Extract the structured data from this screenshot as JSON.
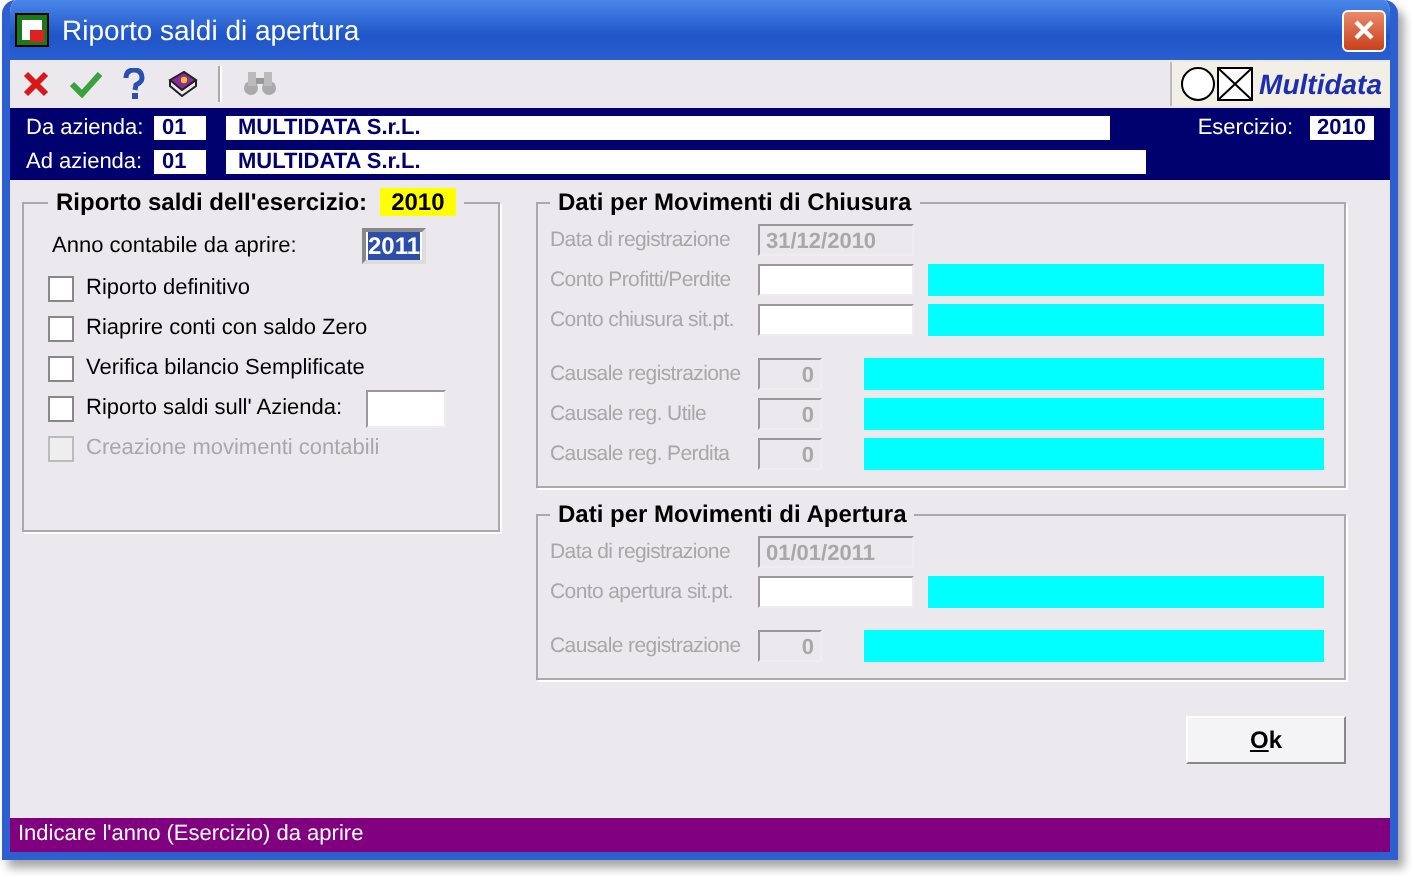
{
  "window": {
    "title": "Riporto saldi di apertura"
  },
  "toolbar": {
    "logo": "Multidata"
  },
  "header": {
    "from": {
      "label": "Da azienda:",
      "code": "01",
      "name": "MULTIDATA S.r.L."
    },
    "to": {
      "label": "Ad azienda:",
      "code": "01",
      "name": "MULTIDATA S.r.L."
    },
    "year": {
      "label": "Esercizio:",
      "value": "2010"
    }
  },
  "left": {
    "title": "Riporto saldi dell'esercizio:",
    "year": "2010",
    "open_year": {
      "label": "Anno contabile da aprire:",
      "value": "2011"
    },
    "options": [
      {
        "label": "Riporto definitivo",
        "checked": false,
        "disabled": false,
        "kind": "plain"
      },
      {
        "label": "Riaprire conti con saldo Zero",
        "checked": false,
        "disabled": false,
        "kind": "plain"
      },
      {
        "label": "Verifica bilancio Semplificate",
        "checked": false,
        "disabled": false,
        "kind": "plain"
      },
      {
        "label": "Riporto saldi sull' Azienda:",
        "checked": false,
        "disabled": false,
        "kind": "field"
      },
      {
        "label": "Creazione movimenti contabili",
        "checked": false,
        "disabled": true,
        "kind": "plain"
      }
    ]
  },
  "groups": [
    {
      "title": "Dati per Movimenti di Chiusura",
      "blocks": [
        [
          {
            "label": "Data di registrazione",
            "value": "31/12/2010",
            "kind": "date",
            "disabled": true
          },
          {
            "label": "Conto Profitti/Perdite",
            "kind": "account",
            "disabled": true
          },
          {
            "label": "Conto chiusura sit.pt.",
            "kind": "account",
            "disabled": true
          }
        ],
        [
          {
            "label": "Causale registrazione",
            "value": "0",
            "kind": "cause",
            "disabled": true
          },
          {
            "label": "Causale reg. Utile",
            "value": "0",
            "kind": "cause",
            "disabled": true
          },
          {
            "label": "Causale reg. Perdita",
            "value": "0",
            "kind": "cause",
            "disabled": true
          }
        ]
      ]
    },
    {
      "title": "Dati per Movimenti di Apertura",
      "blocks": [
        [
          {
            "label": "Data di registrazione",
            "value": "01/01/2011",
            "kind": "date",
            "disabled": true
          },
          {
            "label": "Conto apertura sit.pt.",
            "kind": "account",
            "disabled": true
          }
        ],
        [
          {
            "label": "Causale registrazione",
            "value": "0",
            "kind": "cause",
            "disabled": true
          }
        ]
      ]
    }
  ],
  "ok_button": "Ok",
  "status_bar": "Indicare l'anno (Esercizio) da aprire"
}
